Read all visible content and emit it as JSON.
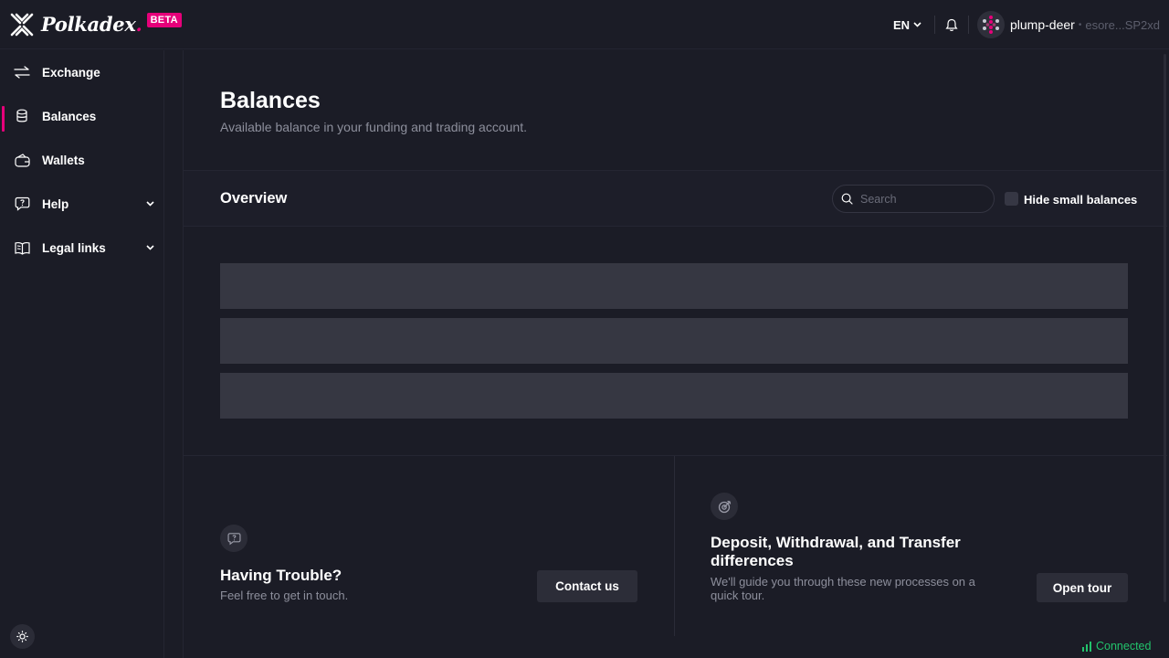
{
  "brand": {
    "name": "Polkadex",
    "name_dot": ".",
    "badge": "BETA",
    "accent": "#e6007a"
  },
  "header": {
    "language": "EN",
    "language_icon": "chevron-down-icon",
    "notification_icon": "bell-icon",
    "account": {
      "name": "plump-deer",
      "separator": "•",
      "address": "esore...SP2xd"
    }
  },
  "sidebar": {
    "items": [
      {
        "label": "Exchange",
        "icon": "arrows-swap-icon",
        "active": false,
        "expandable": false
      },
      {
        "label": "Balances",
        "icon": "coins-icon",
        "active": true,
        "expandable": false
      },
      {
        "label": "Wallets",
        "icon": "wallet-icon",
        "active": false,
        "expandable": false
      },
      {
        "label": "Help",
        "icon": "help-bubble-icon",
        "active": false,
        "expandable": true
      },
      {
        "label": "Legal links",
        "icon": "book-icon",
        "active": false,
        "expandable": true
      }
    ],
    "theme_toggle_icon": "sun-icon"
  },
  "page": {
    "title": "Balances",
    "subtitle": "Available balance in your funding and trading account."
  },
  "overview": {
    "title": "Overview",
    "search_placeholder": "Search",
    "hide_small_label": "Hide small balances",
    "hide_small_checked": false,
    "loading_rows": 3
  },
  "help_card": {
    "title": "Having Trouble?",
    "text": "Feel free to get in touch.",
    "button": "Contact us"
  },
  "tour_card": {
    "title_line1": "Deposit, Withdrawal, and Transfer",
    "title_line2": "differences",
    "text_line1": "We'll guide you through these new processes on a",
    "text_line2": "quick tour.",
    "button": "Open tour"
  },
  "status": {
    "label": "Connected",
    "color": "#22c36c"
  }
}
